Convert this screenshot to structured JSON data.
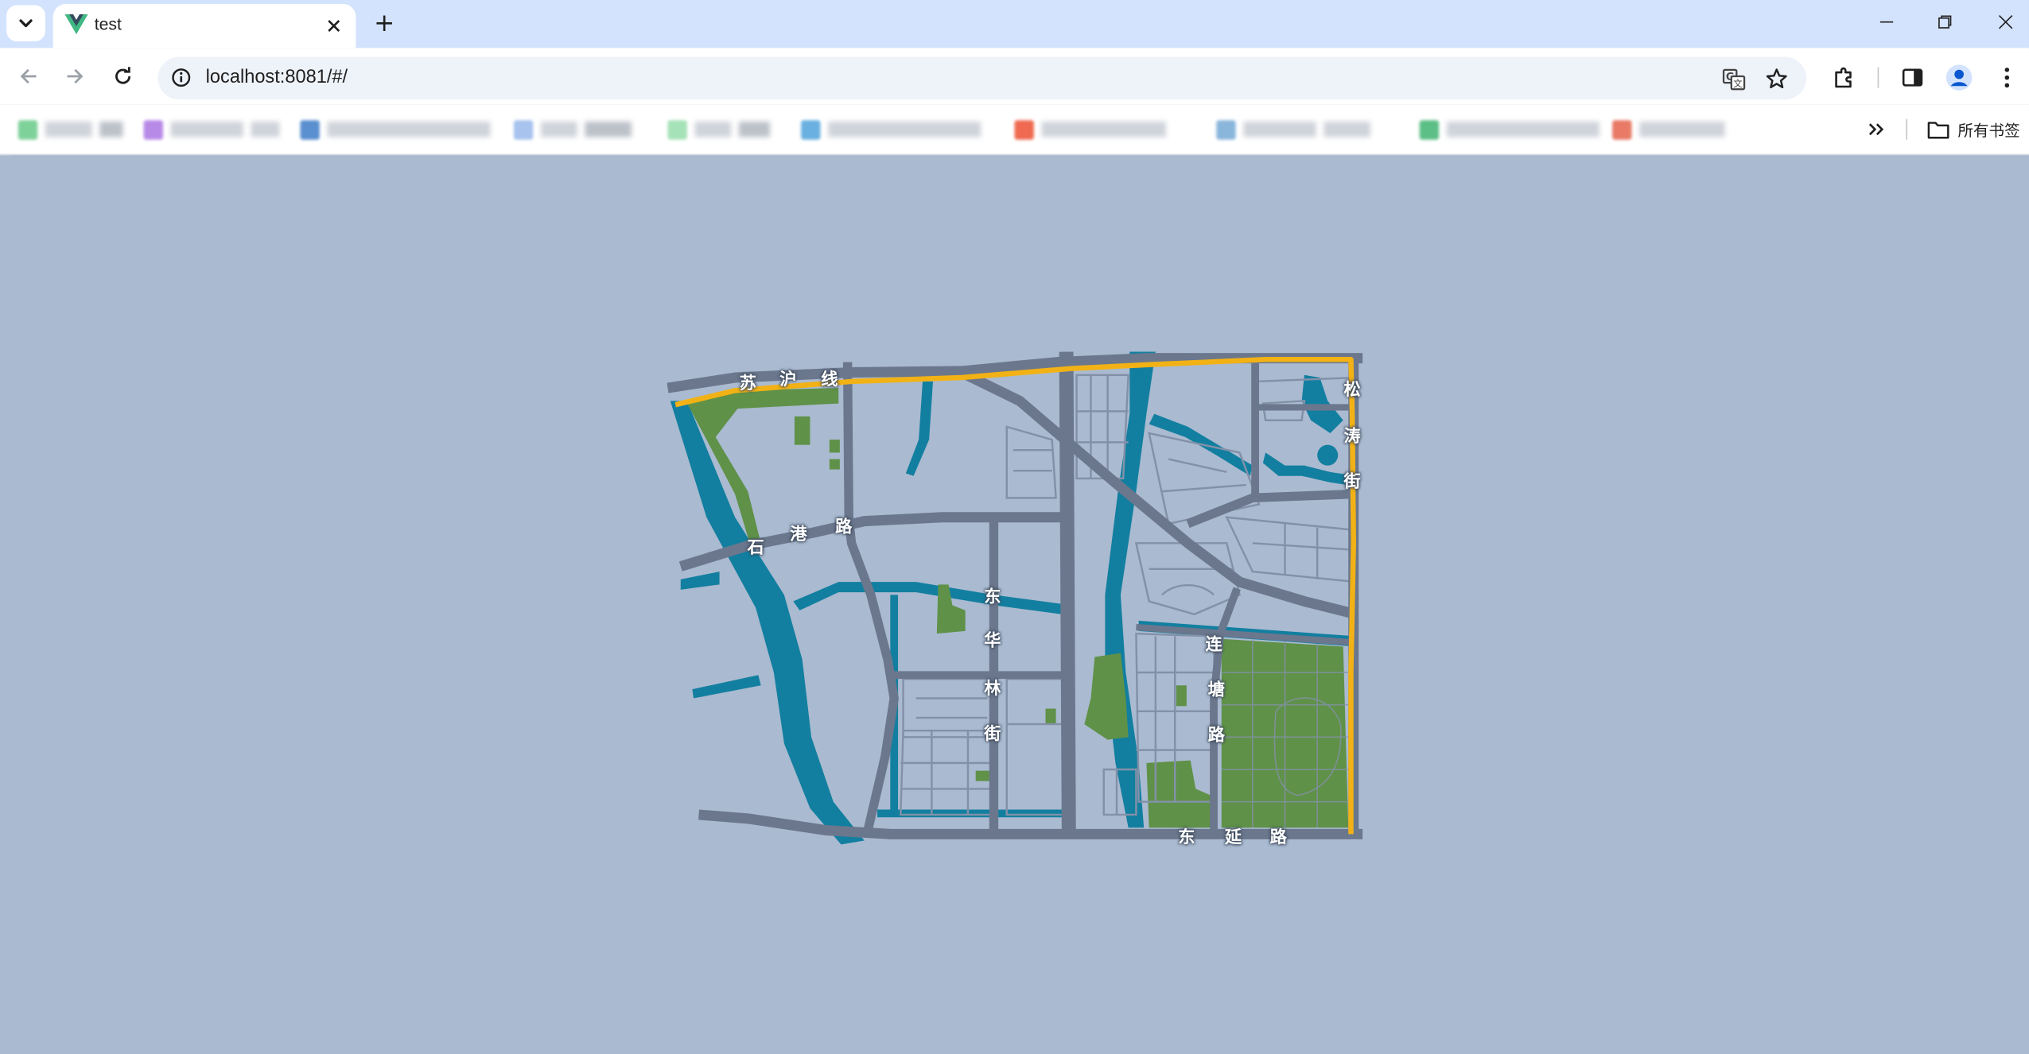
{
  "browser": {
    "tab": {
      "title": "test",
      "favicon": "vue-logo-icon"
    },
    "address": {
      "url": "localhost:8081/#/"
    },
    "bookmarks_bar": {
      "overflow_icon": "chevrons-right-icon",
      "folder_label": "所有书签"
    }
  },
  "map": {
    "colors": {
      "background": "#aabad0",
      "road": "#6b778d",
      "minor_road": "#8391a8",
      "water": "#127fa0",
      "green": "#5f9148",
      "route": "#f2b215"
    },
    "labels": {
      "road_suhu": [
        "苏",
        "沪",
        "线"
      ],
      "road_shigang": [
        "石",
        "港",
        "路"
      ],
      "road_donghualin": [
        "东",
        "华",
        "林",
        "街"
      ],
      "road_liantang": [
        "连",
        "塘",
        "路"
      ],
      "road_dongyan": [
        "东",
        "延",
        "路"
      ],
      "road_songtao": [
        "松",
        "涛",
        "街"
      ]
    }
  }
}
